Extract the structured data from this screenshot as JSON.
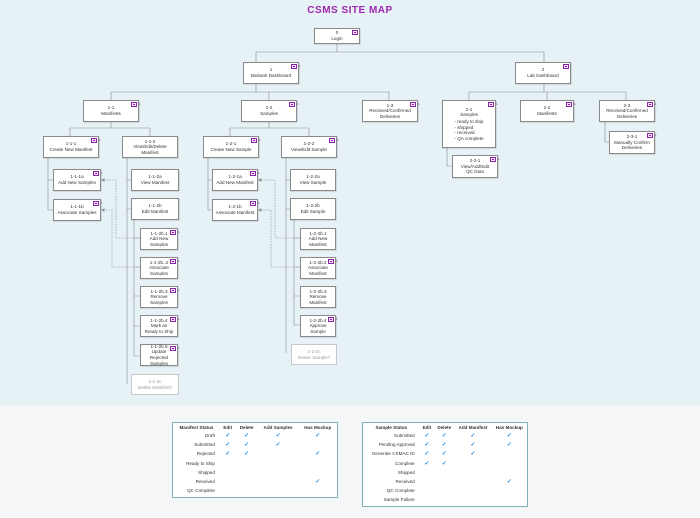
{
  "title": "CSMS SITE MAP",
  "nodes": [
    {
      "id": "n0",
      "label": "0\nLogin"
    },
    {
      "id": "n1",
      "label": "1\nBiobank Dashboard"
    },
    {
      "id": "n2",
      "label": "2\nLab Dashboard"
    },
    {
      "id": "n11",
      "label": "1-1\nManifests"
    },
    {
      "id": "n12",
      "label": "1-2\nSamples"
    },
    {
      "id": "n13",
      "label": "1-3\nReceived/Confirmed\nDeliveries"
    },
    {
      "id": "n21",
      "label": "2-1\nSamples",
      "items": [
        "- ready to ship",
        "- shipped",
        "- received",
        "- QA complete"
      ]
    },
    {
      "id": "n22",
      "label": "2-2\nManifests"
    },
    {
      "id": "n23",
      "label": "2-3\nReceived/Confirmed\nDeliveries"
    },
    {
      "id": "n111",
      "label": "1-1-1\nCreate New Manifest"
    },
    {
      "id": "n112",
      "label": "1-1-2\nView/Edit/Delete\nManifest"
    },
    {
      "id": "n121",
      "label": "1-2-1\nCreate New Sample"
    },
    {
      "id": "n122",
      "label": "1-2-2\nView/Edit Sample"
    },
    {
      "id": "n221",
      "label": "2-2-1\nView/Add/Edit\nQC Data"
    },
    {
      "id": "n231",
      "label": "2-3-1\nManually Confirm\nDeliveries"
    },
    {
      "id": "n111a",
      "label": "1-1-1a\nAdd New Samples"
    },
    {
      "id": "n111b",
      "label": "1-1-1b\nAssociate Samples"
    },
    {
      "id": "n112a",
      "label": "1-1-2a\nView Manifest"
    },
    {
      "id": "n112b",
      "label": "1-1-2b\nEdit Manifest"
    },
    {
      "id": "n112b1",
      "label": "1-1-2b.1\nAdd New\nSamples"
    },
    {
      "id": "n112b2",
      "label": "1-1-2b..2\nAssociate\nSamples"
    },
    {
      "id": "n112b3",
      "label": "1-1-2b.3\nRemove\nSamples"
    },
    {
      "id": "n112b4",
      "label": "1-1-2b.4\nMark as\nReady to Ship"
    },
    {
      "id": "n112b5",
      "label": "1-1-2b.5\nUpdate Rejected\nSamples"
    },
    {
      "id": "n112c",
      "label": "1-1-2c\nDelete Manifest?"
    },
    {
      "id": "n121a",
      "label": "1-2-1a\nAdd New Manifest"
    },
    {
      "id": "n121b",
      "label": "1-2-1b\nAssociate Manifest"
    },
    {
      "id": "n122a",
      "label": "1-2-2a\nView Sample"
    },
    {
      "id": "n122b",
      "label": "1-2-2b\nEdit Sample"
    },
    {
      "id": "n122b1",
      "label": "1-2-2b.1\nAdd New\nManifest"
    },
    {
      "id": "n122b2",
      "label": "1-2-2b.2\nAssociate\nManifest"
    },
    {
      "id": "n122b3",
      "label": "1-2-2b.3\nRemove\nManifest"
    },
    {
      "id": "n122b4",
      "label": "1-2-2b.4\nApprove\nSample"
    },
    {
      "id": "n122c",
      "label": "1-2-2c\nDelete Sample?"
    }
  ],
  "manifest_table": {
    "headers": [
      "Manifest Status",
      "Edit",
      "Delete",
      "Add Samples",
      "Has Mockup"
    ],
    "rows": [
      {
        "status": "Draft",
        "checks": [
          true,
          true,
          true,
          true
        ]
      },
      {
        "status": "Submitted",
        "checks": [
          true,
          true,
          true,
          false
        ]
      },
      {
        "status": "Rejected",
        "checks": [
          true,
          true,
          false,
          true
        ]
      },
      {
        "status": "Ready to Ship",
        "checks": [
          false,
          false,
          false,
          false
        ]
      },
      {
        "status": "Shipped",
        "checks": [
          false,
          false,
          false,
          false
        ]
      },
      {
        "status": "Received",
        "checks": [
          false,
          false,
          false,
          true
        ]
      },
      {
        "status": "QC Complete",
        "checks": [
          false,
          false,
          false,
          false
        ]
      }
    ]
  },
  "sample_table": {
    "headers": [
      "Sample Status",
      "Edit",
      "Delete",
      "Add Manifest",
      "Has Mockup"
    ],
    "rows": [
      {
        "status": "Submitted",
        "checks": [
          true,
          true,
          true,
          true
        ]
      },
      {
        "status": "Pending Approval",
        "checks": [
          true,
          true,
          true,
          true
        ]
      },
      {
        "status": "Generate CSMAC ID",
        "checks": [
          true,
          true,
          true,
          false
        ]
      },
      {
        "status": "Complete",
        "checks": [
          true,
          true,
          false,
          false
        ]
      },
      {
        "status": "Shipped",
        "checks": [
          false,
          false,
          false,
          false
        ]
      },
      {
        "status": "Received",
        "checks": [
          false,
          false,
          false,
          true
        ]
      },
      {
        "status": "QC Complete",
        "checks": [
          false,
          false,
          false,
          false
        ]
      },
      {
        "status": "Sample Failure",
        "checks": [
          false,
          false,
          false,
          false
        ]
      }
    ]
  },
  "check_glyph": "✓",
  "colors": {
    "title": "#9c27b0",
    "icon": "#8e24aa",
    "check": "#1e88e5",
    "connector": "#8a8a8a",
    "table_border": "#7fb1b8"
  }
}
